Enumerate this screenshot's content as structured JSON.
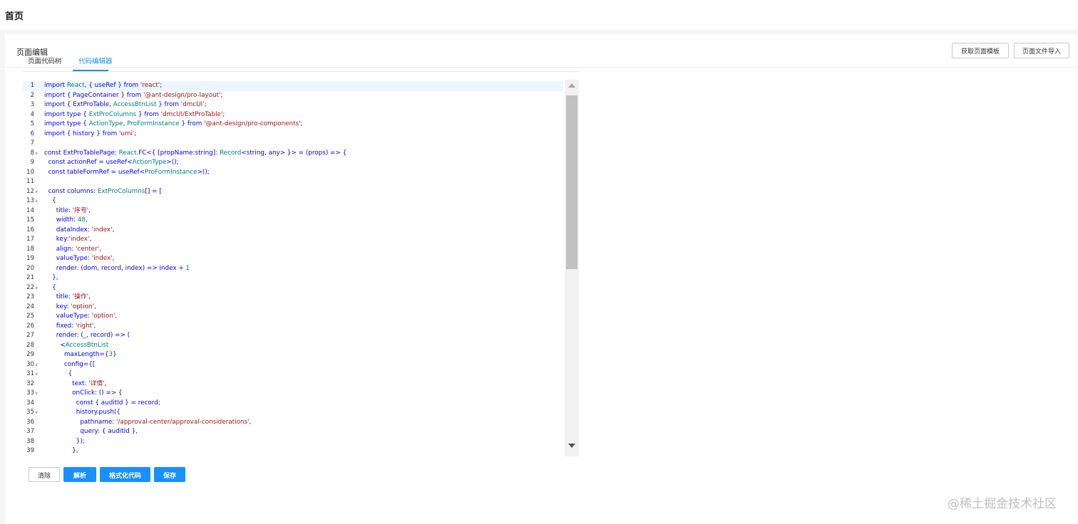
{
  "header": {
    "title": "首页"
  },
  "card": {
    "title": "页面编辑",
    "buttons": {
      "get_template": "获取页面模板",
      "import_file": "页面文件导入"
    }
  },
  "tabs": [
    {
      "label": "页面代码树",
      "active": false
    },
    {
      "label": "代码编辑器",
      "active": true
    }
  ],
  "editor": {
    "lines": [
      {
        "n": "1",
        "fold": false,
        "text": "import React, { useRef } from 'react';"
      },
      {
        "n": "2",
        "fold": false,
        "text": "import { PageContainer } from '@ant-design/pro-layout';"
      },
      {
        "n": "3",
        "fold": false,
        "text": "import { ExtProTable, AccessBtnList } from 'dmcUI';"
      },
      {
        "n": "4",
        "fold": false,
        "text": "import type { ExtProColumns } from 'dmcUI/ExtProTable';"
      },
      {
        "n": "5",
        "fold": false,
        "text": "import type { ActionType, ProFormInstance } from '@ant-design/pro-components';"
      },
      {
        "n": "6",
        "fold": false,
        "text": "import { history } from 'umi';"
      },
      {
        "n": "7",
        "fold": false,
        "text": ""
      },
      {
        "n": "8",
        "fold": true,
        "text": "const ExtProTablePage: React.FC<{ [propName:string]: Record<string, any> }> = (props) => {"
      },
      {
        "n": "9",
        "fold": false,
        "text": "  const actionRef = useRef<ActionType>();"
      },
      {
        "n": "10",
        "fold": false,
        "text": "  const tableFormRef = useRef<ProFormInstance>();"
      },
      {
        "n": "11",
        "fold": false,
        "text": ""
      },
      {
        "n": "12",
        "fold": true,
        "text": "  const columns: ExtProColumns[] = ["
      },
      {
        "n": "13",
        "fold": true,
        "text": "    {"
      },
      {
        "n": "14",
        "fold": false,
        "text": "      title: '序号',"
      },
      {
        "n": "15",
        "fold": false,
        "text": "      width: 48,"
      },
      {
        "n": "16",
        "fold": false,
        "text": "      dataIndex: 'index',"
      },
      {
        "n": "17",
        "fold": false,
        "text": "      key:'index',"
      },
      {
        "n": "18",
        "fold": false,
        "text": "      align: 'center',"
      },
      {
        "n": "19",
        "fold": false,
        "text": "      valueType: 'index',"
      },
      {
        "n": "20",
        "fold": false,
        "text": "      render: (dom, record, index) => index + 1"
      },
      {
        "n": "21",
        "fold": false,
        "text": "    },"
      },
      {
        "n": "22",
        "fold": true,
        "text": "    {"
      },
      {
        "n": "23",
        "fold": false,
        "text": "      title: '操作',"
      },
      {
        "n": "24",
        "fold": false,
        "text": "      key: 'option',"
      },
      {
        "n": "25",
        "fold": false,
        "text": "      valueType: 'option',"
      },
      {
        "n": "26",
        "fold": false,
        "text": "      fixed: 'right',"
      },
      {
        "n": "27",
        "fold": false,
        "text": "      render: (_, record) => ("
      },
      {
        "n": "28",
        "fold": false,
        "text": "        <AccessBtnList"
      },
      {
        "n": "29",
        "fold": false,
        "text": "          maxLength={3}"
      },
      {
        "n": "30",
        "fold": true,
        "text": "          config={["
      },
      {
        "n": "31",
        "fold": true,
        "text": "            {"
      },
      {
        "n": "32",
        "fold": false,
        "text": "              text: '详情',"
      },
      {
        "n": "33",
        "fold": true,
        "text": "              onClick: () => {"
      },
      {
        "n": "34",
        "fold": false,
        "text": "                const { auditId } = record;"
      },
      {
        "n": "35",
        "fold": true,
        "text": "                history.push({"
      },
      {
        "n": "36",
        "fold": false,
        "text": "                  pathname: '/approval-center/approval-considerations',"
      },
      {
        "n": "37",
        "fold": false,
        "text": "                  query: { auditId },"
      },
      {
        "n": "38",
        "fold": false,
        "text": "                });"
      },
      {
        "n": "39",
        "fold": false,
        "text": "              },"
      }
    ]
  },
  "actions": {
    "clear": "清除",
    "parse": "解析",
    "format": "格式化代码",
    "save": "保存"
  },
  "watermark": "@稀土掘金技术社区",
  "colors": {
    "primary": "#1890ff",
    "keyword": "#0000ff",
    "string": "#a31515",
    "type": "#008080"
  }
}
